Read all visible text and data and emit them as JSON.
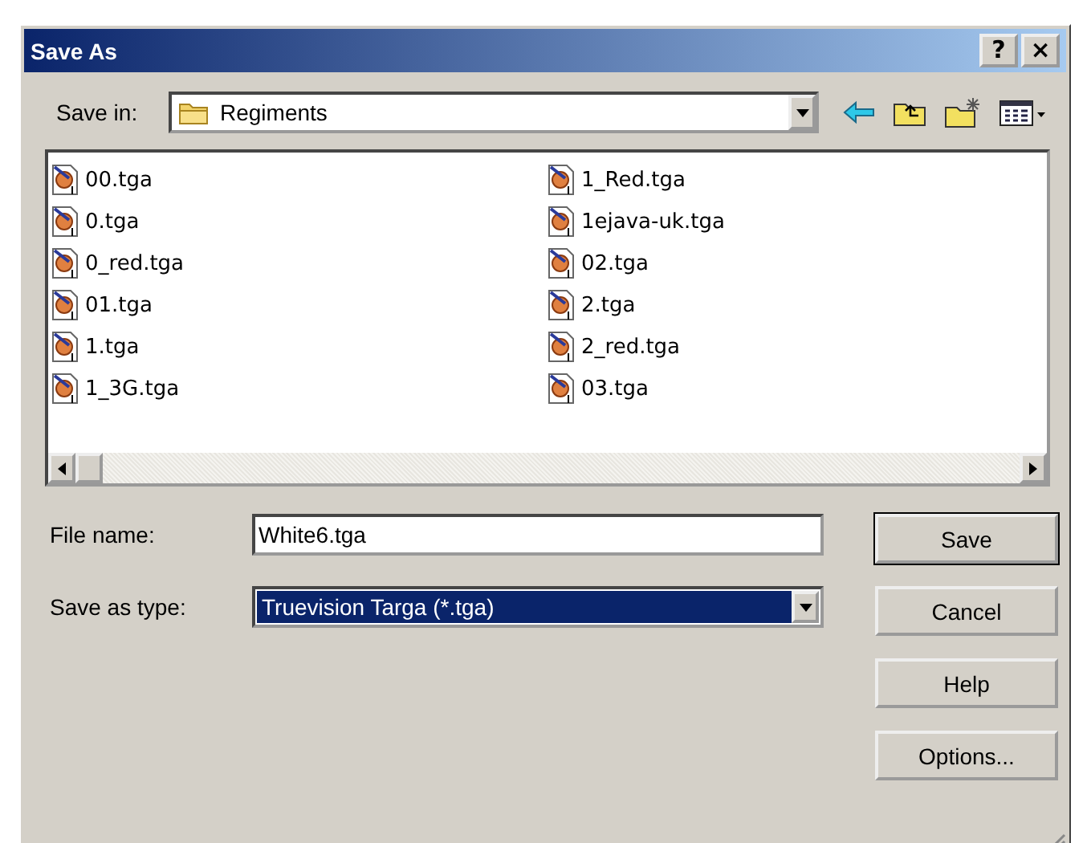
{
  "window": {
    "title": "Save As",
    "help_button": "?",
    "close_button": "×"
  },
  "save_in": {
    "label": "Save in:",
    "value": "Regiments"
  },
  "files": [
    {
      "name": "00.tga"
    },
    {
      "name": "0.tga"
    },
    {
      "name": "0_red.tga"
    },
    {
      "name": "01.tga"
    },
    {
      "name": "1.tga"
    },
    {
      "name": "1_3G.tga"
    },
    {
      "name": "1_Red.tga"
    },
    {
      "name": "1ejava-uk.tga"
    },
    {
      "name": "02.tga"
    },
    {
      "name": "2.tga"
    },
    {
      "name": "2_red.tga"
    },
    {
      "name": "03.tga"
    }
  ],
  "file_name": {
    "label": "File name:",
    "value": "White6.tga"
  },
  "save_as_type": {
    "label": "Save as type:",
    "value": "Truevision Targa (*.tga)",
    "selected": true
  },
  "buttons": [
    {
      "label": "Save",
      "default": true
    },
    {
      "label": "Cancel",
      "default": false
    },
    {
      "label": "Help",
      "default": false
    },
    {
      "label": "Options...",
      "default": false
    }
  ]
}
